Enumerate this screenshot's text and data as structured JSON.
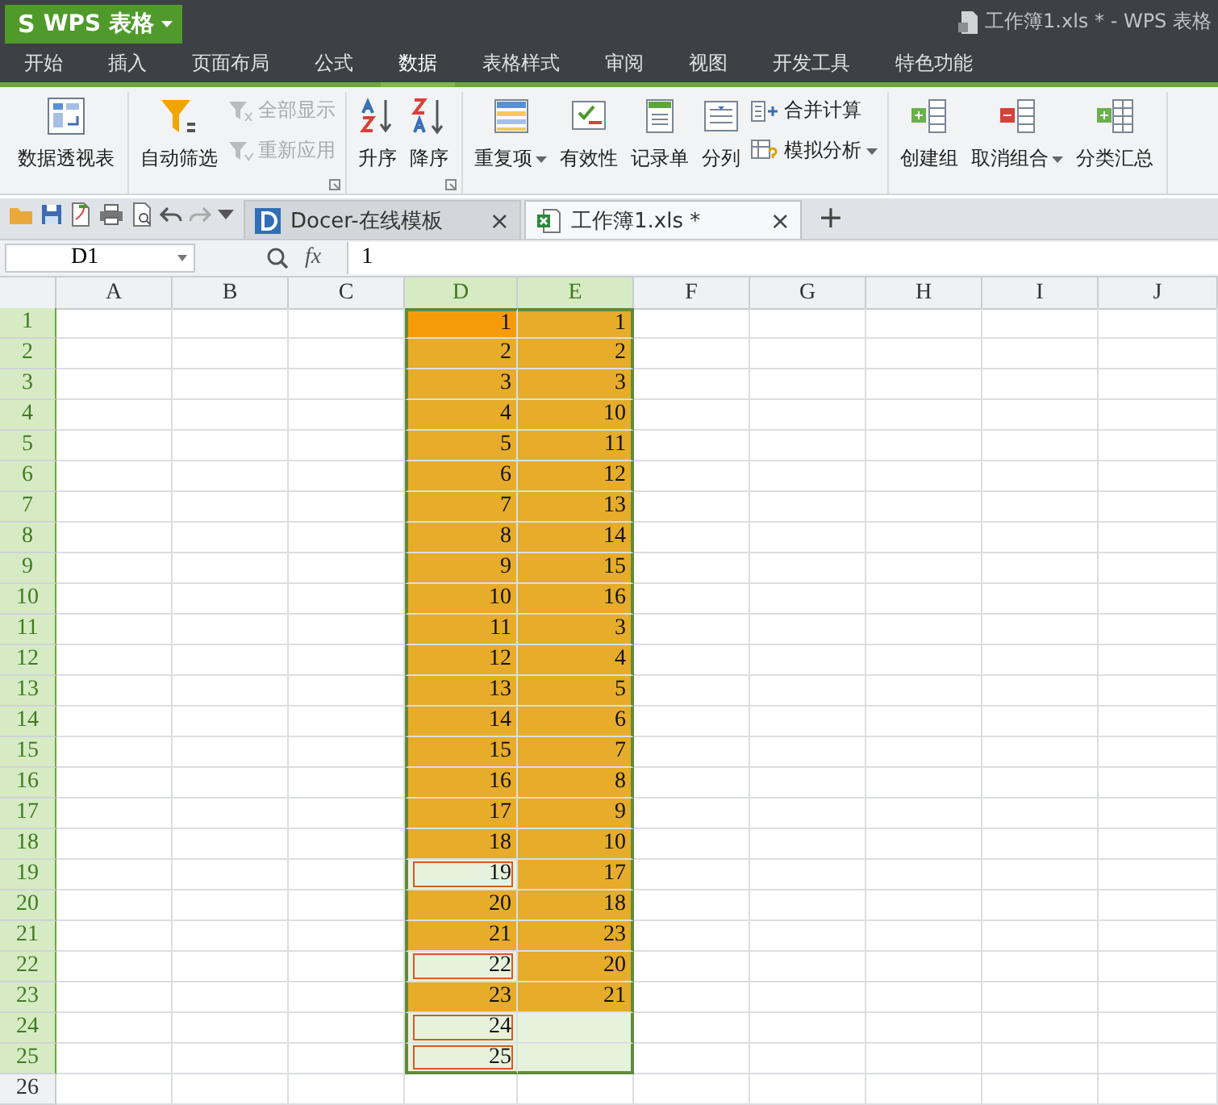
{
  "app_button": {
    "logo": "S",
    "label": "WPS 表格"
  },
  "window": {
    "title": "工作簿1.xls * - WPS 表格"
  },
  "menu_tabs": [
    {
      "label": "开始",
      "selected": false
    },
    {
      "label": "插入",
      "selected": false
    },
    {
      "label": "页面布局",
      "selected": false
    },
    {
      "label": "公式",
      "selected": false
    },
    {
      "label": "数据",
      "selected": true
    },
    {
      "label": "表格样式",
      "selected": false
    },
    {
      "label": "审阅",
      "selected": false
    },
    {
      "label": "视图",
      "selected": false
    },
    {
      "label": "开发工具",
      "selected": false
    },
    {
      "label": "特色功能",
      "selected": false
    }
  ],
  "ribbon": [
    {
      "items": [
        {
          "kind": "large",
          "label": "数据透视表"
        }
      ]
    },
    {
      "launcher": true,
      "items": [
        {
          "kind": "large",
          "label": "自动筛选"
        },
        {
          "kind": "pair",
          "entries": [
            {
              "label": "全部显示",
              "disabled": true
            },
            {
              "label": "重新应用",
              "disabled": true
            }
          ]
        }
      ]
    },
    {
      "launcher": true,
      "items": [
        {
          "kind": "large",
          "label": "升序"
        },
        {
          "kind": "large",
          "label": "降序"
        }
      ]
    },
    {
      "items": [
        {
          "kind": "large",
          "label": "重复项",
          "caret": true
        },
        {
          "kind": "large",
          "label": "有效性"
        },
        {
          "kind": "large",
          "label": "记录单"
        },
        {
          "kind": "large",
          "label": "分列"
        },
        {
          "kind": "pair",
          "entries": [
            {
              "label": "合并计算",
              "disabled": false
            },
            {
              "label": "模拟分析",
              "disabled": false,
              "caret": true
            }
          ]
        }
      ]
    },
    {
      "items": [
        {
          "kind": "large",
          "label": "创建组"
        },
        {
          "kind": "large",
          "label": "取消组合",
          "caret": true
        },
        {
          "kind": "large",
          "label": "分类汇总"
        }
      ]
    }
  ],
  "doc_tabs": [
    {
      "kind": "docer",
      "label": "Docer-在线模板",
      "selected": false,
      "close": "×"
    },
    {
      "kind": "sheet",
      "label": "工作簿1.xls *",
      "selected": true,
      "close": "×"
    }
  ],
  "new_tab": "+",
  "formula_bar": {
    "name_box": "D1",
    "fx": "fx",
    "value": "1"
  },
  "columns": [
    {
      "label": "A",
      "selected": false
    },
    {
      "label": "B",
      "selected": false
    },
    {
      "label": "C",
      "selected": false
    },
    {
      "label": "D",
      "selected": true
    },
    {
      "label": "E",
      "selected": true
    },
    {
      "label": "F",
      "selected": false
    },
    {
      "label": "G",
      "selected": false
    },
    {
      "label": "H",
      "selected": false
    },
    {
      "label": "I",
      "selected": false
    },
    {
      "label": "J",
      "selected": false
    }
  ],
  "rows": [
    {
      "n": "1",
      "selected": true,
      "d": {
        "v": "1",
        "selected": true,
        "highlighted": true,
        "active": true,
        "boxed": false
      },
      "e": {
        "v": "1",
        "selected": true,
        "highlighted": true
      }
    },
    {
      "n": "2",
      "selected": true,
      "d": {
        "v": "2",
        "selected": true,
        "highlighted": true,
        "active": false,
        "boxed": false
      },
      "e": {
        "v": "2",
        "selected": true,
        "highlighted": true
      }
    },
    {
      "n": "3",
      "selected": true,
      "d": {
        "v": "3",
        "selected": true,
        "highlighted": true,
        "active": false,
        "boxed": false
      },
      "e": {
        "v": "3",
        "selected": true,
        "highlighted": true
      }
    },
    {
      "n": "4",
      "selected": true,
      "d": {
        "v": "4",
        "selected": true,
        "highlighted": true,
        "active": false,
        "boxed": false
      },
      "e": {
        "v": "10",
        "selected": true,
        "highlighted": true
      }
    },
    {
      "n": "5",
      "selected": true,
      "d": {
        "v": "5",
        "selected": true,
        "highlighted": true,
        "active": false,
        "boxed": false
      },
      "e": {
        "v": "11",
        "selected": true,
        "highlighted": true
      }
    },
    {
      "n": "6",
      "selected": true,
      "d": {
        "v": "6",
        "selected": true,
        "highlighted": true,
        "active": false,
        "boxed": false
      },
      "e": {
        "v": "12",
        "selected": true,
        "highlighted": true
      }
    },
    {
      "n": "7",
      "selected": true,
      "d": {
        "v": "7",
        "selected": true,
        "highlighted": true,
        "active": false,
        "boxed": false
      },
      "e": {
        "v": "13",
        "selected": true,
        "highlighted": true
      }
    },
    {
      "n": "8",
      "selected": true,
      "d": {
        "v": "8",
        "selected": true,
        "highlighted": true,
        "active": false,
        "boxed": false
      },
      "e": {
        "v": "14",
        "selected": true,
        "highlighted": true
      }
    },
    {
      "n": "9",
      "selected": true,
      "d": {
        "v": "9",
        "selected": true,
        "highlighted": true,
        "active": false,
        "boxed": false
      },
      "e": {
        "v": "15",
        "selected": true,
        "highlighted": true
      }
    },
    {
      "n": "10",
      "selected": true,
      "d": {
        "v": "10",
        "selected": true,
        "highlighted": true,
        "active": false,
        "boxed": false
      },
      "e": {
        "v": "16",
        "selected": true,
        "highlighted": true
      }
    },
    {
      "n": "11",
      "selected": true,
      "d": {
        "v": "11",
        "selected": true,
        "highlighted": true,
        "active": false,
        "boxed": false
      },
      "e": {
        "v": "3",
        "selected": true,
        "highlighted": true
      }
    },
    {
      "n": "12",
      "selected": true,
      "d": {
        "v": "12",
        "selected": true,
        "highlighted": true,
        "active": false,
        "boxed": false
      },
      "e": {
        "v": "4",
        "selected": true,
        "highlighted": true
      }
    },
    {
      "n": "13",
      "selected": true,
      "d": {
        "v": "13",
        "selected": true,
        "highlighted": true,
        "active": false,
        "boxed": false
      },
      "e": {
        "v": "5",
        "selected": true,
        "highlighted": true
      }
    },
    {
      "n": "14",
      "selected": true,
      "d": {
        "v": "14",
        "selected": true,
        "highlighted": true,
        "active": false,
        "boxed": false
      },
      "e": {
        "v": "6",
        "selected": true,
        "highlighted": true
      }
    },
    {
      "n": "15",
      "selected": true,
      "d": {
        "v": "15",
        "selected": true,
        "highlighted": true,
        "active": false,
        "boxed": false
      },
      "e": {
        "v": "7",
        "selected": true,
        "highlighted": true
      }
    },
    {
      "n": "16",
      "selected": true,
      "d": {
        "v": "16",
        "selected": true,
        "highlighted": true,
        "active": false,
        "boxed": false
      },
      "e": {
        "v": "8",
        "selected": true,
        "highlighted": true
      }
    },
    {
      "n": "17",
      "selected": true,
      "d": {
        "v": "17",
        "selected": true,
        "highlighted": true,
        "active": false,
        "boxed": false
      },
      "e": {
        "v": "9",
        "selected": true,
        "highlighted": true
      }
    },
    {
      "n": "18",
      "selected": true,
      "d": {
        "v": "18",
        "selected": true,
        "highlighted": true,
        "active": false,
        "boxed": false
      },
      "e": {
        "v": "10",
        "selected": true,
        "highlighted": true
      }
    },
    {
      "n": "19",
      "selected": true,
      "d": {
        "v": "19",
        "selected": true,
        "highlighted": false,
        "active": false,
        "boxed": true
      },
      "e": {
        "v": "17",
        "selected": true,
        "highlighted": true
      }
    },
    {
      "n": "20",
      "selected": true,
      "d": {
        "v": "20",
        "selected": true,
        "highlighted": true,
        "active": false,
        "boxed": false
      },
      "e": {
        "v": "18",
        "selected": true,
        "highlighted": true
      }
    },
    {
      "n": "21",
      "selected": true,
      "d": {
        "v": "21",
        "selected": true,
        "highlighted": true,
        "active": false,
        "boxed": false
      },
      "e": {
        "v": "23",
        "selected": true,
        "highlighted": true
      }
    },
    {
      "n": "22",
      "selected": true,
      "d": {
        "v": "22",
        "selected": true,
        "highlighted": false,
        "active": false,
        "boxed": true
      },
      "e": {
        "v": "20",
        "selected": true,
        "highlighted": true
      }
    },
    {
      "n": "23",
      "selected": true,
      "d": {
        "v": "23",
        "selected": true,
        "highlighted": true,
        "active": false,
        "boxed": false
      },
      "e": {
        "v": "21",
        "selected": true,
        "highlighted": true
      }
    },
    {
      "n": "24",
      "selected": true,
      "d": {
        "v": "24",
        "selected": true,
        "highlighted": false,
        "active": false,
        "boxed": true
      },
      "e": {
        "selected": true,
        "highlighted": false
      }
    },
    {
      "n": "25",
      "selected": true,
      "d": {
        "v": "25",
        "selected": true,
        "highlighted": false,
        "active": false,
        "boxed": true
      },
      "e": {
        "selected": true,
        "highlighted": false
      }
    },
    {
      "n": "26",
      "selected": false,
      "d": {
        "selected": false,
        "highlighted": false,
        "active": false,
        "boxed": false
      },
      "e": {
        "selected": false,
        "highlighted": false
      }
    }
  ]
}
